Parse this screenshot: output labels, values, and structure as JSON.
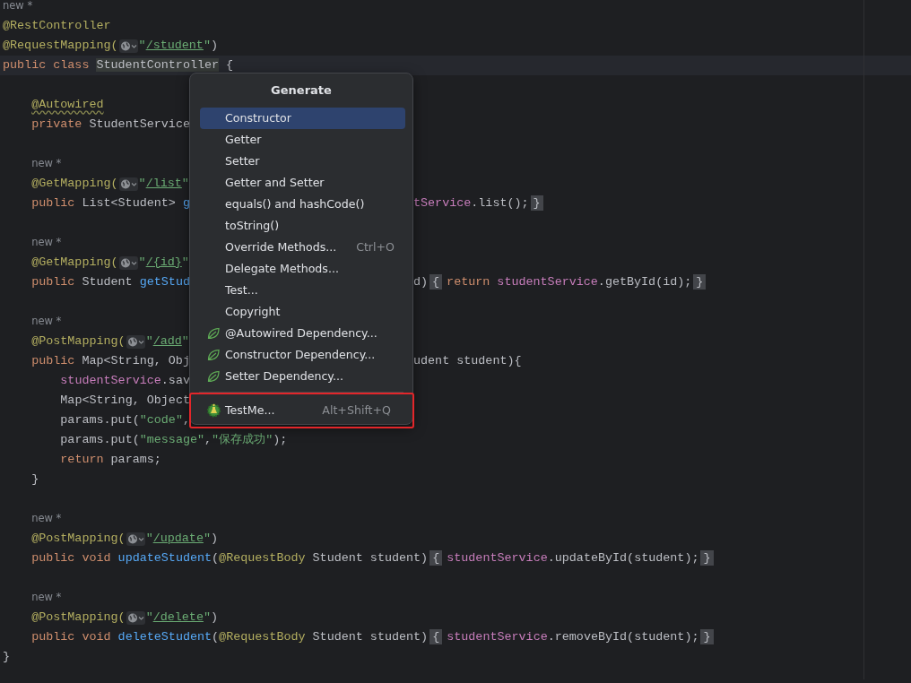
{
  "editor": {
    "lines": [
      {
        "kind": "hint",
        "text": "new *"
      },
      {
        "kind": "code",
        "parts": [
          {
            "kind": "text",
            "tokens": [
              {
                "t": "@RestController",
                "kind": "ann"
              }
            ]
          }
        ]
      },
      {
        "kind": "code",
        "parts": [
          {
            "kind": "text",
            "tokens": [
              {
                "t": "@RequestMapping(",
                "kind": "ann"
              }
            ]
          },
          {
            "kind": "globe"
          },
          {
            "kind": "text",
            "tokens": [
              {
                "t": "\"",
                "kind": "str"
              },
              {
                "t": "/student",
                "kind": "link"
              },
              {
                "t": "\"",
                "kind": "str"
              },
              {
                "t": ")",
                "kind": "plain"
              }
            ]
          }
        ]
      },
      {
        "kind": "code",
        "current": true,
        "parts": [
          {
            "kind": "text",
            "tokens": [
              {
                "t": "public class ",
                "kind": "kw"
              },
              {
                "t": "StudentController",
                "kind": "usage"
              },
              {
                "t": " {",
                "kind": "plain"
              }
            ]
          }
        ],
        "children": [
          {
            "kind": "blank"
          },
          {
            "kind": "code",
            "parts": [
              {
                "kind": "text",
                "tokens": [
                  {
                    "t": "@Autowired",
                    "kind": "ann",
                    "warning": true
                  }
                ]
              }
            ]
          },
          {
            "kind": "code",
            "parts": [
              {
                "kind": "text",
                "tokens": [
                  {
                    "t": "private ",
                    "kind": "kw"
                  },
                  {
                    "t": "StudentService",
                    "kind": "plain"
                  }
                ]
              }
            ]
          },
          {
            "kind": "blank"
          },
          {
            "kind": "hint",
            "text": "new *"
          },
          {
            "kind": "code",
            "parts": [
              {
                "kind": "text",
                "tokens": [
                  {
                    "t": "@GetMapping(",
                    "kind": "ann"
                  }
                ]
              },
              {
                "kind": "globe"
              },
              {
                "kind": "text",
                "tokens": [
                  {
                    "t": "\"",
                    "kind": "str"
                  },
                  {
                    "t": "/list",
                    "kind": "link"
                  },
                  {
                    "t": "\"",
                    "kind": "str"
                  }
                ]
              }
            ]
          },
          {
            "kind": "code",
            "parts": [
              {
                "kind": "text",
                "tokens": [
                  {
                    "t": "public ",
                    "kind": "kw"
                  },
                  {
                    "t": "List<Student> ",
                    "kind": "plain"
                  },
                  {
                    "t": "g",
                    "kind": "method"
                  }
                ]
              },
              {
                "kind": "gap"
              },
              {
                "kind": "text",
                "tokens": [
                  {
                    "t": "tService",
                    "kind": "field"
                  },
                  {
                    "t": ".list();",
                    "kind": "plain"
                  },
                  {
                    "t": "}",
                    "kind": "fold"
                  }
                ]
              }
            ]
          },
          {
            "kind": "blank"
          },
          {
            "kind": "hint",
            "text": "new *"
          },
          {
            "kind": "code",
            "parts": [
              {
                "kind": "text",
                "tokens": [
                  {
                    "t": "@GetMapping(",
                    "kind": "ann"
                  }
                ]
              },
              {
                "kind": "globe"
              },
              {
                "kind": "text",
                "tokens": [
                  {
                    "t": "\"",
                    "kind": "str"
                  },
                  {
                    "t": "/{id}",
                    "kind": "link"
                  },
                  {
                    "t": "\"",
                    "kind": "str"
                  }
                ]
              }
            ]
          },
          {
            "kind": "code",
            "parts": [
              {
                "kind": "text",
                "tokens": [
                  {
                    "t": "public ",
                    "kind": "kw"
                  },
                  {
                    "t": "Student ",
                    "kind": "plain"
                  },
                  {
                    "t": "getStud",
                    "kind": "method"
                  }
                ]
              },
              {
                "kind": "gap"
              },
              {
                "kind": "text",
                "tokens": [
                  {
                    "t": "d)",
                    "kind": "plain"
                  },
                  {
                    "t": "{",
                    "kind": "fold"
                  },
                  {
                    "t": "return ",
                    "kind": "kw"
                  },
                  {
                    "t": "studentService",
                    "kind": "field"
                  },
                  {
                    "t": ".getById(id);",
                    "kind": "plain"
                  },
                  {
                    "t": "}",
                    "kind": "fold"
                  }
                ]
              }
            ]
          },
          {
            "kind": "blank"
          },
          {
            "kind": "hint",
            "text": "new *"
          },
          {
            "kind": "code",
            "parts": [
              {
                "kind": "text",
                "tokens": [
                  {
                    "t": "@PostMapping(",
                    "kind": "ann"
                  }
                ]
              },
              {
                "kind": "globe"
              },
              {
                "kind": "text",
                "tokens": [
                  {
                    "t": "\"",
                    "kind": "str"
                  },
                  {
                    "t": "/add",
                    "kind": "link"
                  },
                  {
                    "t": "\"",
                    "kind": "str"
                  }
                ]
              }
            ]
          },
          {
            "kind": "code",
            "parts": [
              {
                "kind": "text",
                "tokens": [
                  {
                    "t": "public ",
                    "kind": "kw"
                  },
                  {
                    "t": "Map<String, Obj",
                    "kind": "plain"
                  }
                ]
              },
              {
                "kind": "gap"
              },
              {
                "kind": "text",
                "tokens": [
                  {
                    "t": "udent student){",
                    "kind": "plain"
                  }
                ]
              }
            ],
            "children": [
              {
                "kind": "code",
                "parts": [
                  {
                    "kind": "text",
                    "tokens": [
                      {
                        "t": "studentService",
                        "kind": "field"
                      },
                      {
                        "t": ".sav",
                        "kind": "plain"
                      }
                    ]
                  }
                ]
              },
              {
                "kind": "code",
                "parts": [
                  {
                    "kind": "text",
                    "tokens": [
                      {
                        "t": "Map<String, Object",
                        "kind": "plain"
                      }
                    ]
                  }
                ]
              },
              {
                "kind": "code",
                "parts": [
                  {
                    "kind": "text",
                    "tokens": [
                      {
                        "t": "params.put(",
                        "kind": "plain"
                      },
                      {
                        "t": "\"code\"",
                        "kind": "str"
                      },
                      {
                        "t": ",",
                        "kind": "plain"
                      }
                    ]
                  }
                ]
              },
              {
                "kind": "code",
                "parts": [
                  {
                    "kind": "text",
                    "tokens": [
                      {
                        "t": "params.put(",
                        "kind": "plain"
                      },
                      {
                        "t": "\"message\"",
                        "kind": "str"
                      },
                      {
                        "t": ",",
                        "kind": "plain"
                      },
                      {
                        "t": "\"保存成功\"",
                        "kind": "str"
                      },
                      {
                        "t": ");",
                        "kind": "plain"
                      }
                    ]
                  }
                ]
              },
              {
                "kind": "code",
                "parts": [
                  {
                    "kind": "text",
                    "tokens": [
                      {
                        "t": "return ",
                        "kind": "kw"
                      },
                      {
                        "t": "params;",
                        "kind": "plain"
                      }
                    ]
                  }
                ]
              }
            ]
          },
          {
            "kind": "code",
            "parts": [
              {
                "kind": "text",
                "tokens": [
                  {
                    "t": "}",
                    "kind": "plain"
                  }
                ]
              }
            ]
          },
          {
            "kind": "blank"
          },
          {
            "kind": "hint",
            "text": "new *"
          },
          {
            "kind": "code",
            "parts": [
              {
                "kind": "text",
                "tokens": [
                  {
                    "t": "@PostMapping(",
                    "kind": "ann"
                  }
                ]
              },
              {
                "kind": "globe"
              },
              {
                "kind": "text",
                "tokens": [
                  {
                    "t": "\"",
                    "kind": "str"
                  },
                  {
                    "t": "/update",
                    "kind": "link"
                  },
                  {
                    "t": "\"",
                    "kind": "str"
                  },
                  {
                    "t": ")",
                    "kind": "plain"
                  }
                ]
              }
            ]
          },
          {
            "kind": "code",
            "parts": [
              {
                "kind": "text",
                "tokens": [
                  {
                    "t": "public void ",
                    "kind": "kw"
                  },
                  {
                    "t": "updateStudent",
                    "kind": "method"
                  },
                  {
                    "t": "(",
                    "kind": "plain"
                  },
                  {
                    "t": "@RequestBody",
                    "kind": "ann"
                  },
                  {
                    "t": " Student student)",
                    "kind": "plain"
                  },
                  {
                    "t": "{",
                    "kind": "fold"
                  },
                  {
                    "t": "studentService",
                    "kind": "field"
                  },
                  {
                    "t": ".updateById(student);",
                    "kind": "plain"
                  },
                  {
                    "t": "}",
                    "kind": "fold"
                  }
                ]
              }
            ]
          },
          {
            "kind": "blank"
          },
          {
            "kind": "hint",
            "text": "new *"
          },
          {
            "kind": "code",
            "parts": [
              {
                "kind": "text",
                "tokens": [
                  {
                    "t": "@PostMapping(",
                    "kind": "ann"
                  }
                ]
              },
              {
                "kind": "globe"
              },
              {
                "kind": "text",
                "tokens": [
                  {
                    "t": "\"",
                    "kind": "str"
                  },
                  {
                    "t": "/delete",
                    "kind": "link"
                  },
                  {
                    "t": "\"",
                    "kind": "str"
                  },
                  {
                    "t": ")",
                    "kind": "plain"
                  }
                ]
              }
            ]
          },
          {
            "kind": "code",
            "parts": [
              {
                "kind": "text",
                "tokens": [
                  {
                    "t": "public void ",
                    "kind": "kw"
                  },
                  {
                    "t": "deleteStudent",
                    "kind": "method"
                  },
                  {
                    "t": "(",
                    "kind": "plain"
                  },
                  {
                    "t": "@RequestBody",
                    "kind": "ann"
                  },
                  {
                    "t": " Student student)",
                    "kind": "plain"
                  },
                  {
                    "t": "{",
                    "kind": "fold"
                  },
                  {
                    "t": "studentService",
                    "kind": "field"
                  },
                  {
                    "t": ".removeById(student);",
                    "kind": "plain"
                  },
                  {
                    "t": "}",
                    "kind": "fold"
                  }
                ]
              }
            ]
          }
        ]
      },
      {
        "kind": "code",
        "parts": [
          {
            "kind": "text",
            "tokens": [
              {
                "t": "}",
                "kind": "plain"
              }
            ]
          }
        ]
      }
    ]
  },
  "generate_menu": {
    "title": "Generate",
    "items": [
      {
        "kind": "plain",
        "label": "Constructor",
        "selected": true,
        "highlighted": false
      },
      {
        "kind": "plain",
        "label": "Getter",
        "selected": false,
        "highlighted": false
      },
      {
        "kind": "plain",
        "label": "Setter",
        "selected": false,
        "highlighted": false
      },
      {
        "kind": "plain",
        "label": "Getter and Setter",
        "selected": false,
        "highlighted": false
      },
      {
        "kind": "plain",
        "label": "equals() and hashCode()",
        "selected": false,
        "highlighted": false
      },
      {
        "kind": "plain",
        "label": "toString()",
        "selected": false,
        "highlighted": false
      },
      {
        "kind": "plain",
        "label": "Override Methods...",
        "shortcut": "Ctrl+O",
        "selected": false,
        "highlighted": false
      },
      {
        "kind": "plain",
        "label": "Delegate Methods...",
        "selected": false,
        "highlighted": false
      },
      {
        "kind": "plain",
        "label": "Test...",
        "selected": false,
        "highlighted": false
      },
      {
        "kind": "plain",
        "label": "Copyright",
        "selected": false,
        "highlighted": false
      },
      {
        "kind": "spring",
        "label": "@Autowired Dependency...",
        "selected": false,
        "highlighted": false
      },
      {
        "kind": "spring",
        "label": "Constructor Dependency...",
        "selected": false,
        "highlighted": false
      },
      {
        "kind": "spring",
        "label": "Setter Dependency...",
        "selected": false,
        "highlighted": false
      },
      {
        "kind": "plugin",
        "label": "TestMe...",
        "shortcut": "Alt+Shift+Q",
        "separator_before": true,
        "selected": false,
        "highlighted": true
      }
    ]
  }
}
